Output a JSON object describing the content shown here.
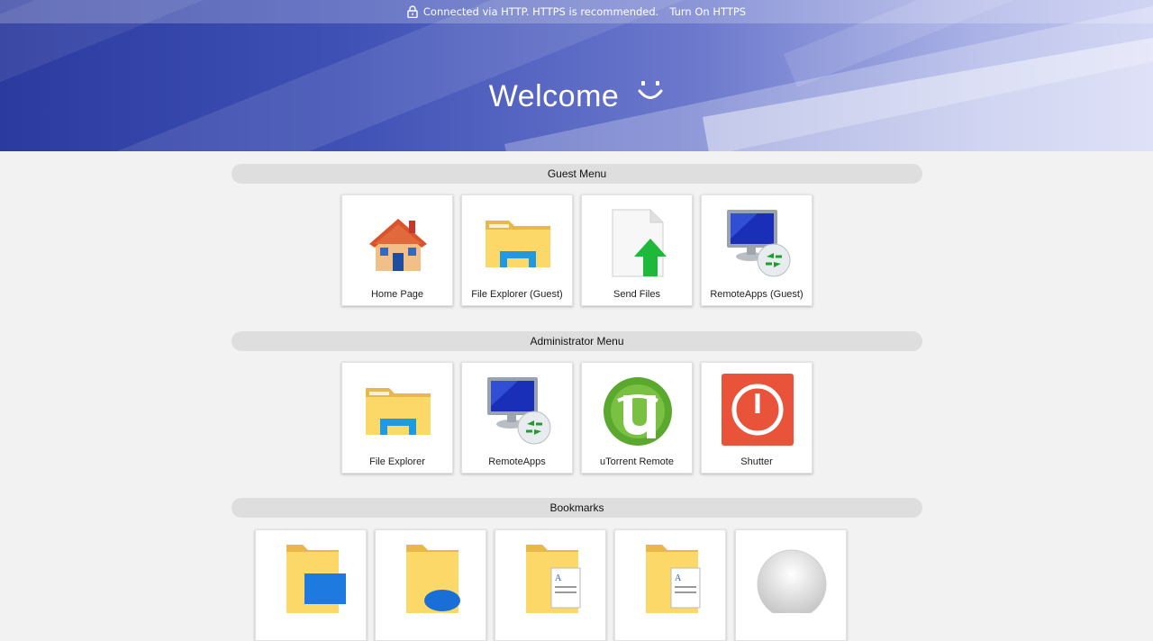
{
  "notice": {
    "text": "Connected via HTTP. HTTPS is recommended.",
    "action": "Turn On HTTPS"
  },
  "welcome": "Welcome",
  "sections": {
    "guest": {
      "title": "Guest Menu",
      "items": [
        {
          "label": "Home Page",
          "icon": "house-icon"
        },
        {
          "label": "File Explorer (Guest)",
          "icon": "folder-icon"
        },
        {
          "label": "Send Files",
          "icon": "upload-file-icon"
        },
        {
          "label": "RemoteApps (Guest)",
          "icon": "remote-monitor-icon"
        }
      ]
    },
    "admin": {
      "title": "Administrator Menu",
      "items": [
        {
          "label": "File Explorer",
          "icon": "folder-icon"
        },
        {
          "label": "RemoteApps",
          "icon": "remote-monitor-icon"
        },
        {
          "label": "uTorrent Remote",
          "icon": "utorrent-icon"
        },
        {
          "label": "Shutter",
          "icon": "power-icon"
        }
      ]
    },
    "bookmarks": {
      "title": "Bookmarks",
      "items": [
        {
          "icon": "folder-desktop-icon"
        },
        {
          "icon": "folder-onedrive-icon"
        },
        {
          "icon": "folder-documents-icon"
        },
        {
          "icon": "folder-documents-icon"
        },
        {
          "icon": "globe-ball-icon"
        }
      ]
    }
  },
  "colors": {
    "banner_dark": "#2b3a9e",
    "banner_light": "#c4c9f0",
    "page_bg": "#f2f2f2",
    "section_bar": "#dedede"
  }
}
